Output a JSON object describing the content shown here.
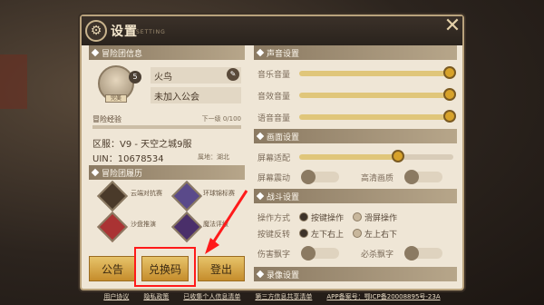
{
  "title": "设置",
  "title_sub": "SETTING",
  "left": {
    "team_info_header": "冒险团信息",
    "player": {
      "name": "火鸟",
      "guild": "未加入公会",
      "level": "5",
      "avatar_tag": "完美"
    },
    "exp": {
      "label": "冒险经验",
      "next": "下一级 0/100"
    },
    "zone": "区服：V9 - 天空之城9服",
    "uin": "UIN：10678534",
    "origin": "属地：湖北",
    "history_header": "冒险团履历",
    "badges": [
      {
        "label": "云端对抗赛"
      },
      {
        "label": "环球锦标赛"
      },
      {
        "label": "沙盘推演"
      },
      {
        "label": "魔法评级"
      }
    ],
    "buttons": {
      "notice": "公告",
      "redeem": "兑换码",
      "logout": "登出"
    }
  },
  "right": {
    "sound_header": "声音设置",
    "sound": [
      {
        "label": "音乐音量",
        "value": 1.0
      },
      {
        "label": "音效音量",
        "value": 1.0
      },
      {
        "label": "语音音量",
        "value": 1.0
      }
    ],
    "display_header": "画面设置",
    "display": {
      "fit_label": "屏幕适配",
      "fit_value": 0.65,
      "shake_label": "屏幕震动",
      "hd_label": "高清画质"
    },
    "combat_header": "战斗设置",
    "combat": {
      "mode_label": "操作方式",
      "mode_opts": [
        "按键操作",
        "滑屏操作"
      ],
      "reverse_label": "按键反转",
      "reverse_opts": [
        "左下右上",
        "左上右下"
      ],
      "damage_label": "伤害飘字",
      "kill_label": "必杀飘字"
    },
    "record_header": "录像设置"
  },
  "footer": [
    "用户协议",
    "隐私政策",
    "已收集个人信息清单",
    "第三方信息共享清单",
    "APP备案号：鄂ICP备20008895号-23A"
  ],
  "colors": {
    "accent": "#d7a22a",
    "highlight": "#ff1a1a"
  }
}
